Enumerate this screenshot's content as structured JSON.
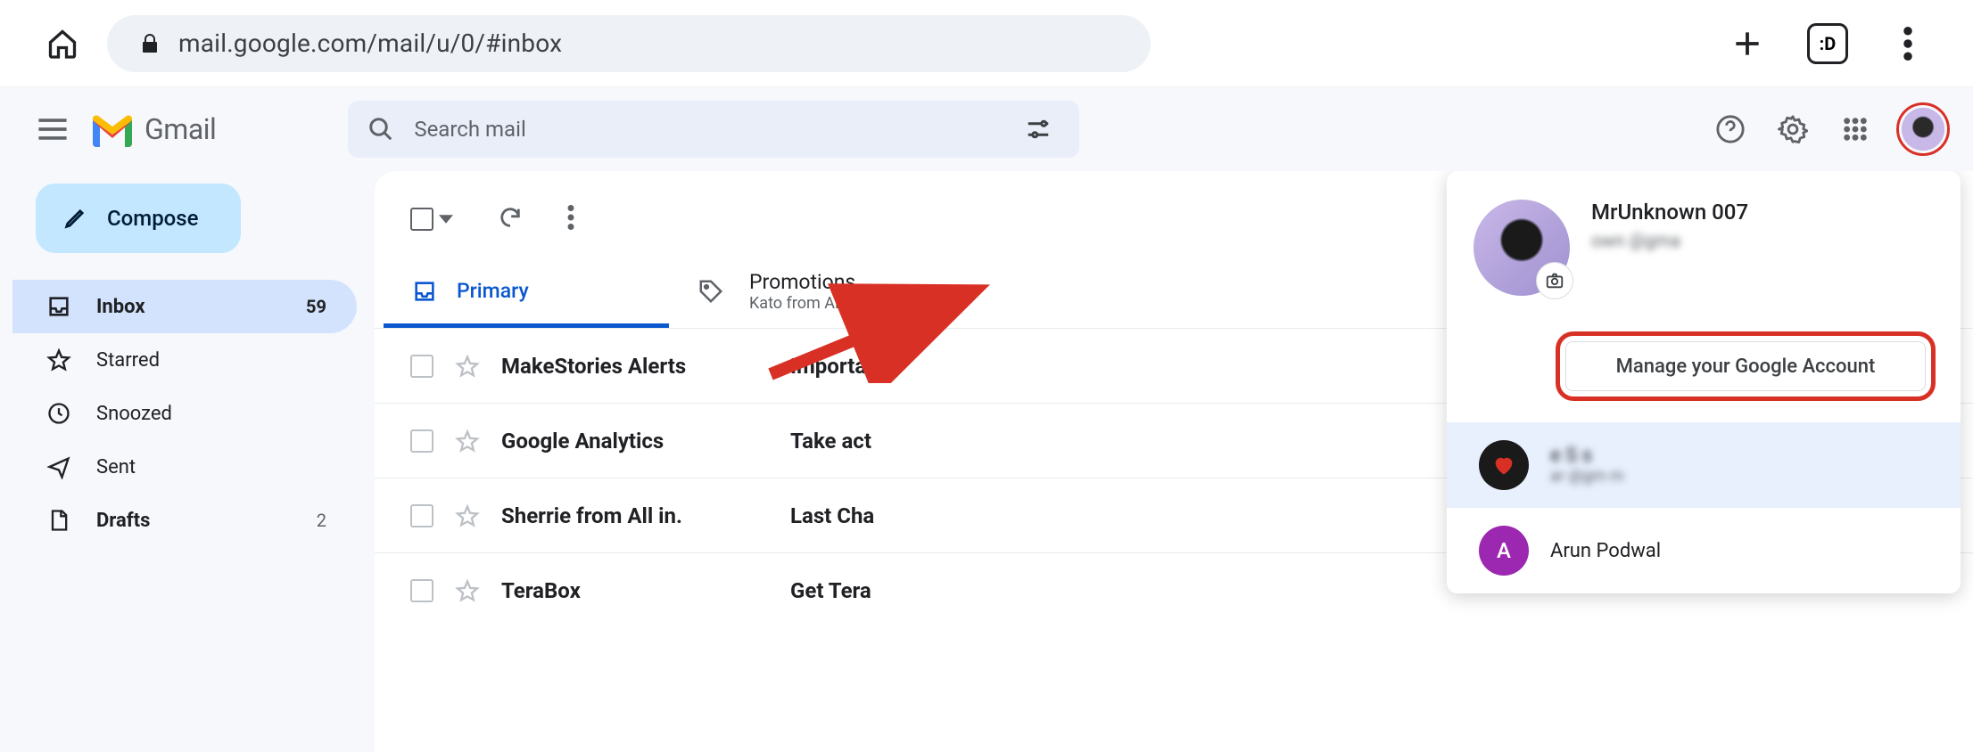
{
  "browser": {
    "url": "mail.google.com/mail/u/0/#inbox",
    "ext_label": ":D"
  },
  "header": {
    "product_name": "Gmail",
    "search_placeholder": "Search mail"
  },
  "sidebar": {
    "compose_label": "Compose",
    "items": [
      {
        "icon": "inbox",
        "label": "Inbox",
        "count": "59",
        "active": true,
        "bold_count": true
      },
      {
        "icon": "star",
        "label": "Starred",
        "count": "",
        "active": false
      },
      {
        "icon": "clock",
        "label": "Snoozed",
        "count": "",
        "active": false
      },
      {
        "icon": "send",
        "label": "Sent",
        "count": "",
        "active": false
      },
      {
        "icon": "draft",
        "label": "Drafts",
        "count": "2",
        "active": false,
        "bold_count": false
      }
    ]
  },
  "tabs": {
    "primary_label": "Primary",
    "promo_title": "Promotions",
    "promo_desc": "Kato from All"
  },
  "emails": [
    {
      "sender": "MakeStories Alerts",
      "subject": "Importa"
    },
    {
      "sender": "Google Analytics",
      "subject": "Take act"
    },
    {
      "sender": "Sherrie from All in.",
      "subject": "Last Cha"
    },
    {
      "sender": "TeraBox",
      "subject": "Get Tera"
    }
  ],
  "popover": {
    "name": "MrUnknown 007",
    "email_partial": "own      @gma",
    "manage_label": "Manage your Google Account",
    "accounts": [
      {
        "name_visible": "e S    s",
        "email_partial": "ar     @gm    m",
        "avatar_bg": "#000",
        "avatar_letter": "♥",
        "highlight": true
      },
      {
        "name_visible": "Arun Podwal",
        "email_partial": "",
        "avatar_bg": "#9c27b0",
        "avatar_letter": "A",
        "highlight": false
      }
    ]
  }
}
